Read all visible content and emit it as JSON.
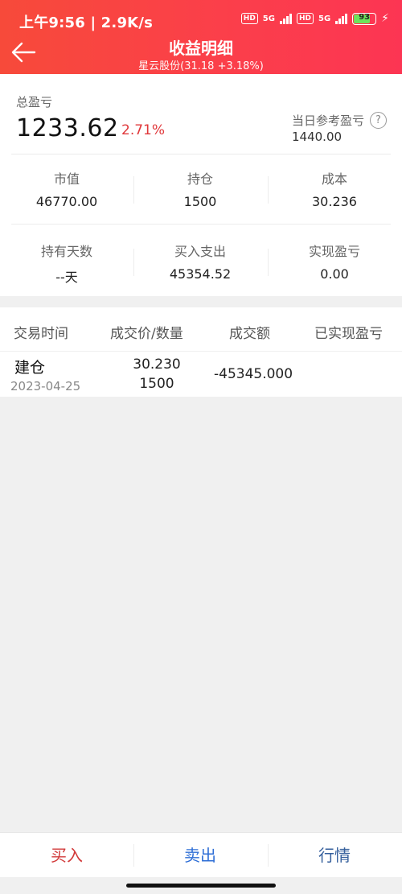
{
  "status_bar": {
    "time_speed": "上午9:56 | 2.9K/s",
    "hd1": "HD",
    "net1": "5G",
    "hd2": "HD",
    "net2": "5G",
    "battery": "93"
  },
  "header": {
    "title": "收益明细",
    "subtitle": "星云股份(31.18 +3.18%)"
  },
  "summary": {
    "total_pl_label": "总盈亏",
    "total_pl_value": "1233.62",
    "total_pl_pct": "2.71%",
    "daily_ref_label": "当日参考盈亏",
    "daily_ref_value": "1440.00",
    "row1": [
      {
        "label": "市值",
        "value": "46770.00"
      },
      {
        "label": "持仓",
        "value": "1500"
      },
      {
        "label": "成本",
        "value": "30.236"
      }
    ],
    "row2": [
      {
        "label": "持有天数",
        "value": "--天"
      },
      {
        "label": "买入支出",
        "value": "45354.52"
      },
      {
        "label": "实现盈亏",
        "value": "0.00"
      }
    ]
  },
  "trades": {
    "headers": [
      "交易时间",
      "成交价/数量",
      "成交额",
      "已实现盈亏"
    ],
    "rows": [
      {
        "type": "建仓",
        "date": "2023-04-25",
        "price": "30.230",
        "qty": "1500",
        "amount": "-45345.000",
        "realized": ""
      }
    ]
  },
  "bottom_bar": {
    "buy": "买入",
    "sell": "卖出",
    "quote": "行情"
  },
  "colors": {
    "header_start": "#f74a3a",
    "header_end": "#fc3553",
    "profit_red": "#e0373a",
    "buy_red": "#d23a3a",
    "sell_blue": "#2f6fd6",
    "quote_blue": "#355f9c"
  },
  "icons": {
    "back": "arrow-left-icon",
    "help": "question-circle-icon"
  }
}
